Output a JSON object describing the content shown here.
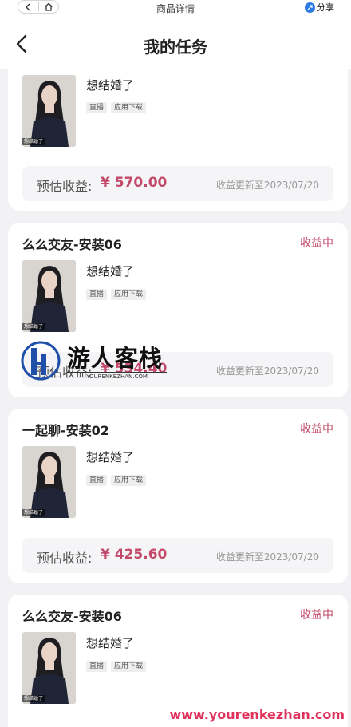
{
  "statusbar": {
    "title": "商品详情",
    "share_label": "分享"
  },
  "header": {
    "title": "我的任务"
  },
  "cards": [
    {
      "title": "",
      "status": "",
      "name": "想结婚了",
      "tags": [
        "直播",
        "应用下载"
      ],
      "thumb_caption": "想结婚了",
      "earn_label": "预估收益:",
      "amount": "¥ 570.00",
      "updated": "收益更新至2023/07/20"
    },
    {
      "title": "么么交友-安装06",
      "status": "收益中",
      "name": "想结婚了",
      "tags": [
        "直播",
        "应用下载"
      ],
      "thumb_caption": "想结婚了",
      "earn_label": "预估收益:",
      "amount": "¥ 534.40",
      "updated": "收益更新至2023/07/20"
    },
    {
      "title": "一起聊-安装02",
      "status": "收益中",
      "name": "想结婚了",
      "tags": [
        "直播",
        "应用下载"
      ],
      "thumb_caption": "想结婚了",
      "earn_label": "预估收益:",
      "amount": "¥ 425.60",
      "updated": "收益更新至2023/07/20"
    },
    {
      "title": "么么交友-安装06",
      "status": "收益中",
      "name": "想结婚了",
      "tags": [
        "直播",
        "应用下载"
      ],
      "thumb_caption": "想结婚了"
    }
  ],
  "watermark": {
    "name": "游人客栈",
    "sub": "YOURENKEZHAN.COM",
    "url": "www.yourenkezhan.com"
  },
  "colors": {
    "accent": "#c2496a",
    "share_blue": "#2b7be4"
  }
}
